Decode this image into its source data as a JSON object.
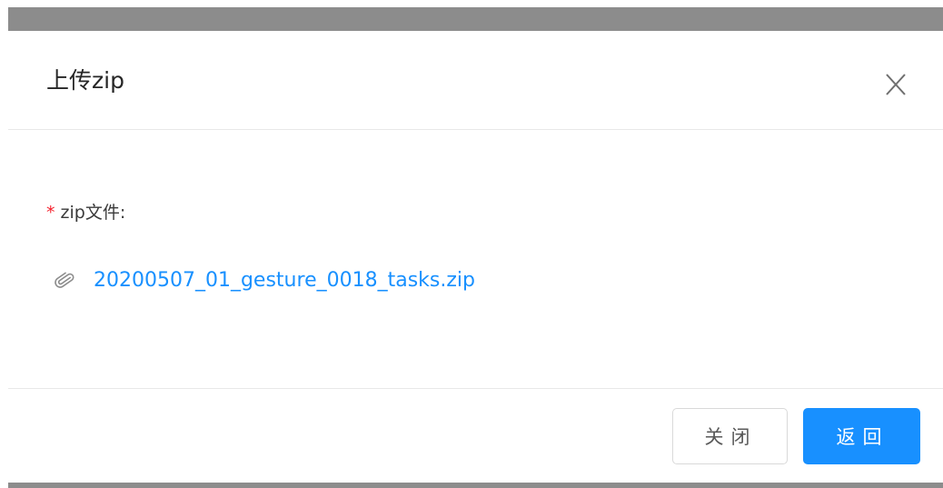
{
  "modal": {
    "title": "上传zip",
    "close_icon": "close-icon"
  },
  "form": {
    "required_mark": "*",
    "label": "zip文件:",
    "file": {
      "icon": "paperclip-icon",
      "name": "20200507_01_gesture_0018_tasks.zip"
    }
  },
  "footer": {
    "close_label": "关闭",
    "return_label": "返回"
  },
  "colors": {
    "primary": "#1890ff",
    "required": "#f5222d",
    "overlay": "#8c8c8c"
  }
}
